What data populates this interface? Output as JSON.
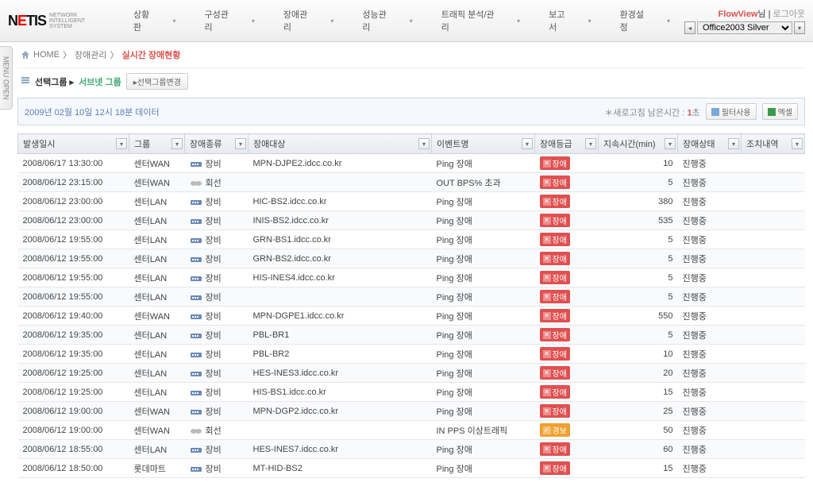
{
  "header": {
    "logo_main": "NETIS",
    "logo_sub1": "NETWORK",
    "logo_sub2": "INTELLIGENT",
    "logo_sub3": "SYSTEM",
    "nav": [
      "상황판",
      "구성관리",
      "장애관리",
      "성능관리",
      "트래픽 분석/관리",
      "보고서",
      "환경설정"
    ],
    "user": "FlowView",
    "user_suffix": "님",
    "logout": "로그아웃",
    "theme": "Office2003 Silver"
  },
  "breadcrumb": {
    "home": "HOME",
    "mid": "장애관리",
    "current": "실시간 장애현황"
  },
  "group": {
    "label": "선택그룹 ▸",
    "value": "서브넷 그룹",
    "change_btn": "▸선택그룹변경"
  },
  "infobar": {
    "time_text": "2009년 02월 10일 12시 18분 데이터",
    "refresh_label": "＊새로고침 남은시간 : ",
    "refresh_sec": "1",
    "refresh_unit": "초",
    "filter_btn": "필터사용",
    "excel_btn": "엑셀"
  },
  "columns": [
    "발생일시",
    "그룹",
    "장애종류",
    "장애대상",
    "이벤트명",
    "장애등급",
    "지속시간(min)",
    "장애상태",
    "조치내역"
  ],
  "rows": [
    {
      "dt": "2008/06/17 13:30:00",
      "grp": "센터WAN",
      "kind": "장비",
      "kicon": "dev",
      "target": "MPN-DJPE2.idcc.co.kr",
      "event": "Ping 장애",
      "grade": "장애",
      "gcolor": "red",
      "dur": "10",
      "state": "진행중"
    },
    {
      "dt": "2008/06/12 23:15:00",
      "grp": "센터WAN",
      "kind": "회선",
      "kicon": "line",
      "target": "",
      "event": "OUT BPS% 초과",
      "grade": "장애",
      "gcolor": "red",
      "dur": "5",
      "state": "진행중"
    },
    {
      "dt": "2008/06/12 23:00:00",
      "grp": "센터LAN",
      "kind": "장비",
      "kicon": "dev",
      "target": "HIC-BS2.idcc.co.kr",
      "event": "Ping 장애",
      "grade": "장애",
      "gcolor": "red",
      "dur": "380",
      "state": "진행중"
    },
    {
      "dt": "2008/06/12 23:00:00",
      "grp": "센터LAN",
      "kind": "장비",
      "kicon": "dev",
      "target": "INIS-BS2.idcc.co.kr",
      "event": "Ping 장애",
      "grade": "장애",
      "gcolor": "red",
      "dur": "535",
      "state": "진행중"
    },
    {
      "dt": "2008/06/12 19:55:00",
      "grp": "센터LAN",
      "kind": "장비",
      "kicon": "dev",
      "target": "GRN-BS1.idcc.co.kr",
      "event": "Ping 장애",
      "grade": "장애",
      "gcolor": "red",
      "dur": "5",
      "state": "진행중"
    },
    {
      "dt": "2008/06/12 19:55:00",
      "grp": "센터LAN",
      "kind": "장비",
      "kicon": "dev",
      "target": "GRN-BS2.idcc.co.kr",
      "event": "Ping 장애",
      "grade": "장애",
      "gcolor": "red",
      "dur": "5",
      "state": "진행중"
    },
    {
      "dt": "2008/06/12 19:55:00",
      "grp": "센터LAN",
      "kind": "장비",
      "kicon": "dev",
      "target": "HIS-INES4.idcc.co.kr",
      "event": "Ping 장애",
      "grade": "장애",
      "gcolor": "red",
      "dur": "5",
      "state": "진행중"
    },
    {
      "dt": "2008/06/12 19:55:00",
      "grp": "센터LAN",
      "kind": "장비",
      "kicon": "dev",
      "target": "",
      "event": "Ping 장애",
      "grade": "장애",
      "gcolor": "red",
      "dur": "5",
      "state": "진행중"
    },
    {
      "dt": "2008/06/12 19:40:00",
      "grp": "센터WAN",
      "kind": "장비",
      "kicon": "dev",
      "target": "MPN-DGPE1.idcc.co.kr",
      "event": "Ping 장애",
      "grade": "장애",
      "gcolor": "red",
      "dur": "550",
      "state": "진행중"
    },
    {
      "dt": "2008/06/12 19:35:00",
      "grp": "센터LAN",
      "kind": "장비",
      "kicon": "dev",
      "target": "PBL-BR1",
      "event": "Ping 장애",
      "grade": "장애",
      "gcolor": "red",
      "dur": "5",
      "state": "진행중"
    },
    {
      "dt": "2008/06/12 19:35:00",
      "grp": "센터LAN",
      "kind": "장비",
      "kicon": "dev",
      "target": "PBL-BR2",
      "event": "Ping 장애",
      "grade": "장애",
      "gcolor": "red",
      "dur": "10",
      "state": "진행중"
    },
    {
      "dt": "2008/06/12 19:25:00",
      "grp": "센터LAN",
      "kind": "장비",
      "kicon": "dev",
      "target": "HES-INES3.idcc.co.kr",
      "event": "Ping 장애",
      "grade": "장애",
      "gcolor": "red",
      "dur": "20",
      "state": "진행중"
    },
    {
      "dt": "2008/06/12 19:25:00",
      "grp": "센터LAN",
      "kind": "장비",
      "kicon": "dev",
      "target": "HIS-BS1.idcc.co.kr",
      "event": "Ping 장애",
      "grade": "장애",
      "gcolor": "red",
      "dur": "15",
      "state": "진행중"
    },
    {
      "dt": "2008/06/12 19:00:00",
      "grp": "센터WAN",
      "kind": "장비",
      "kicon": "dev",
      "target": "MPN-DGP2.idcc.co.kr",
      "event": "Ping 장애",
      "grade": "장애",
      "gcolor": "red",
      "dur": "25",
      "state": "진행중"
    },
    {
      "dt": "2008/06/12 19:00:00",
      "grp": "센터WAN",
      "kind": "회선",
      "kicon": "line",
      "target": "",
      "event": "IN PPS 이상트래픽",
      "grade": "경보",
      "gcolor": "orange",
      "dur": "50",
      "state": "진행중"
    },
    {
      "dt": "2008/06/12 18:55:00",
      "grp": "센터LAN",
      "kind": "장비",
      "kicon": "dev",
      "target": "HES-INES7.idcc.co.kr",
      "event": "Ping 장애",
      "grade": "장애",
      "gcolor": "red",
      "dur": "60",
      "state": "진행중"
    },
    {
      "dt": "2008/06/12 18:50:00",
      "grp": "롯데마트",
      "kind": "장비",
      "kicon": "dev",
      "target": "MT-HID-BS2",
      "event": "Ping 장애",
      "grade": "장애",
      "gcolor": "red",
      "dur": "15",
      "state": "진행중"
    }
  ]
}
